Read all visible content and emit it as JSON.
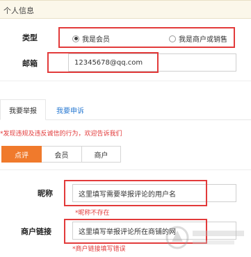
{
  "personal": {
    "title": "个人信息",
    "type_label": "类型",
    "type_options": [
      "我是会员",
      "我是商户或销售"
    ],
    "email_label": "邮箱",
    "email_value": "12345678@qq.com"
  },
  "tabs": [
    "我要举报",
    "我要申诉"
  ],
  "notice": "*发现违规及违反诚信的行为，欢迎告诉我们",
  "segments": [
    "点评",
    "会员",
    "商户"
  ],
  "report": {
    "nickname_label": "昵称",
    "nickname_value": "这里填写需要举报评论的用户名",
    "nickname_error": "*昵称不存在",
    "link_label": "商户链接",
    "link_value": "这里填写举报评论所在商铺的网",
    "link_error": "*商户链接填写错误"
  },
  "colors": {
    "accent": "#f07a2c",
    "error": "#e23a3a",
    "link": "#2a7ad2"
  }
}
